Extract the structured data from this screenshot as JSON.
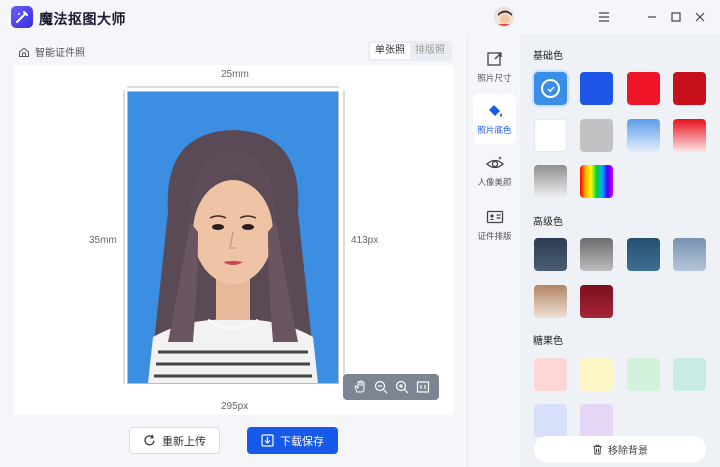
{
  "app": {
    "title": "魔法抠图大师"
  },
  "breadcrumb": {
    "label": "智能证件照"
  },
  "view_mode": {
    "single": "单张照",
    "layout": "排版照"
  },
  "canvas": {
    "width_label": "25mm",
    "height_label": "35mm",
    "height_px_label": "413px",
    "width_px_label": "295px"
  },
  "actions": {
    "reupload": "重新上传",
    "download": "下载保存"
  },
  "rail": {
    "size": "照片尺寸",
    "color": "照片底色",
    "beauty": "人像美颜",
    "layout": "证件排版"
  },
  "colors": {
    "basic_title": "基础色",
    "advanced_title": "高级色",
    "candy_title": "糖果色",
    "basic": [
      "#3a8ee6",
      "#1e56e8",
      "#ef1426",
      "#c8101d",
      "#ffffff",
      "#c2c2c2",
      "gradient-blue",
      "gradient-red",
      "gradient-gray",
      "gradient-rainbow"
    ],
    "advanced": [
      "#34475e",
      "gradient-gray-dark",
      "#2e5878",
      "#8aa4c2",
      "gradient-tan",
      "#8c1526"
    ],
    "candy": [
      "#fcd7d6",
      "#fdf6c6",
      "#d3f2dc",
      "#c8ebe6",
      "#d7dffa",
      "#e6d6f6"
    ]
  },
  "remove_bg": "移除背景"
}
